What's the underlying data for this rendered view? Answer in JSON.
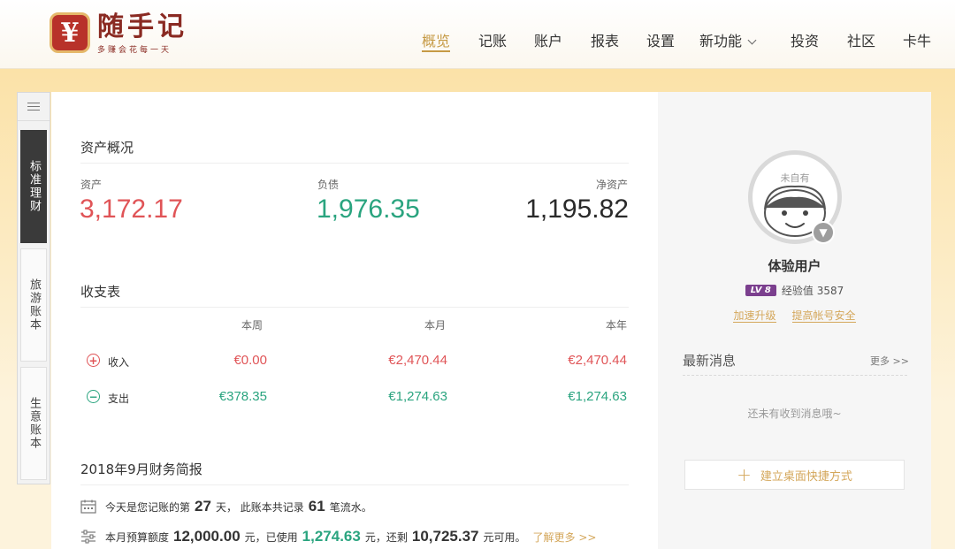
{
  "brand": {
    "logo_glyph": "¥",
    "name": "随手记",
    "slogan": "多赚会花每一天",
    "color": "#b8322a"
  },
  "nav": {
    "items": [
      {
        "label": "概览",
        "active": true
      },
      {
        "label": "记账"
      },
      {
        "label": "账户"
      },
      {
        "label": "报表"
      },
      {
        "label": "设置"
      },
      {
        "label": "新功能",
        "dropdown": true
      },
      {
        "label": "投资"
      },
      {
        "label": "社区"
      },
      {
        "label": "卡牛"
      }
    ],
    "accent": "#c69a45"
  },
  "side_tabs": {
    "items": [
      {
        "label": "标准理财",
        "active": true
      },
      {
        "label": "旅游账本"
      },
      {
        "label": "生意账本"
      }
    ]
  },
  "assets": {
    "title": "资产概况",
    "asset_label": "资产",
    "asset_value": "3,172.17",
    "liability_label": "负债",
    "liability_value": "1,976.35",
    "net_label": "净资产",
    "net_value": "1,195.82"
  },
  "income_expense": {
    "title": "收支表",
    "columns": [
      "本周",
      "本月",
      "本年"
    ],
    "rows": [
      {
        "label": "收入",
        "values": [
          "€0.00",
          "€2,470.44",
          "€2,470.44"
        ]
      },
      {
        "label": "支出",
        "values": [
          "€378.35",
          "€1,274.63",
          "€1,274.63"
        ]
      }
    ]
  },
  "report": {
    "title": "2018年9月财务简报",
    "line1": {
      "t1": "今天是您记账的第",
      "days": "27",
      "t2": "天，  此账本共记录",
      "records": "61",
      "t3": "笔流水。"
    },
    "line2": {
      "t1": "本月预算额度",
      "budget": "12,000.00",
      "t2": "元，已使用",
      "used": "1,274.63",
      "t3": "元，还剩",
      "remaining": "10,725.37",
      "t4": "元可用。",
      "more": "了解更多 >>"
    }
  },
  "profile": {
    "avatar_text": "未自有",
    "username": "体验用户",
    "level": "LV 8",
    "exp": "经验值 3587",
    "link_upgrade": "加速升级",
    "link_security": "提高帐号安全"
  },
  "news": {
    "title": "最新消息",
    "more": "更多 >>",
    "empty": "还未有收到消息哦~"
  },
  "shortcut": {
    "label": "建立桌面快捷方式"
  }
}
